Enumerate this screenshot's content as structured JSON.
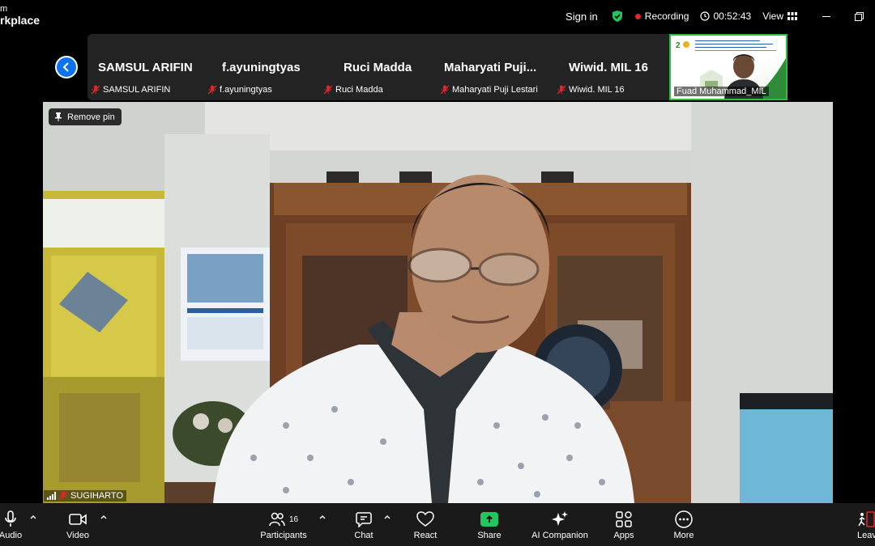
{
  "app": {
    "brand_line1": "m",
    "brand_line2": "rkplace"
  },
  "header": {
    "sign_in": "Sign in",
    "recording": "Recording",
    "timer": "00:52:43",
    "view": "View"
  },
  "participants_strip": [
    {
      "name": "SAMSUL ARIFIN",
      "label": "SAMSUL ARIFIN"
    },
    {
      "name": "f.ayuningtyas",
      "label": "f.ayuningtyas"
    },
    {
      "name": "Ruci Madda",
      "label": "Ruci Madda"
    },
    {
      "name": "Maharyati  Puji...",
      "label": "Maharyati Puji Lestari"
    },
    {
      "name": "Wiwid. MIL 16",
      "label": "Wiwid. MIL 16"
    }
  ],
  "video_thumbnail": {
    "label": "Fuad Muhammad_MIL"
  },
  "main": {
    "remove_pin": "Remove pin",
    "speaker": "SUGIHARTO"
  },
  "toolbar": {
    "audio": "Audio",
    "video": "Video",
    "participants": "Participants",
    "participants_count": "16",
    "chat": "Chat",
    "react": "React",
    "share": "Share",
    "ai_companion": "AI Companion",
    "apps": "Apps",
    "more": "More",
    "leave": "Leave"
  },
  "colors": {
    "accent": "#0e72ed",
    "recording": "#e0262b",
    "active_speaker": "#28c03c",
    "share": "#23c55e",
    "muted": "#e0262b"
  }
}
